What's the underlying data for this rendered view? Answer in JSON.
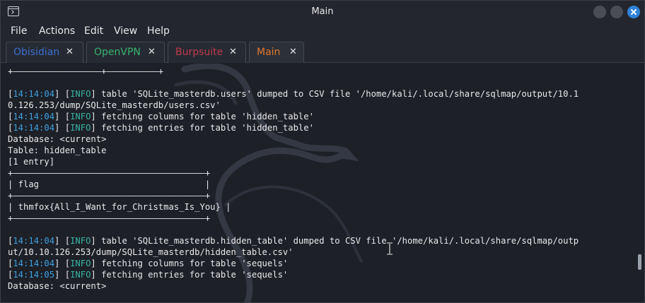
{
  "window": {
    "title": "Main"
  },
  "menu": [
    "File",
    "Actions",
    "Edit",
    "View",
    "Help"
  ],
  "tabs": [
    {
      "label": "Obisidian",
      "color": "#3b6fd1"
    },
    {
      "label": "OpenVPN",
      "color": "#37b36f"
    },
    {
      "label": "Burpsuite",
      "color": "#c03a4b"
    },
    {
      "label": "Main",
      "color": "#e0782d"
    }
  ],
  "terminal": {
    "lines": [
      [
        {
          "t": "+—————————————————+——————————+",
          "c": ""
        }
      ],
      [
        {
          "t": "",
          "c": ""
        }
      ],
      [
        {
          "t": "[",
          "c": ""
        },
        {
          "t": "14:14:04",
          "c": "ts"
        },
        {
          "t": "] [",
          "c": ""
        },
        {
          "t": "INFO",
          "c": "lvl"
        },
        {
          "t": "] table 'SQLite_masterdb.users' dumped to CSV file '/home/kali/.local/share/sqlmap/output/10.1",
          "c": ""
        }
      ],
      [
        {
          "t": "0.126.253/dump/SQLite_masterdb/users.csv'",
          "c": ""
        }
      ],
      [
        {
          "t": "[",
          "c": ""
        },
        {
          "t": "14:14:04",
          "c": "ts"
        },
        {
          "t": "] [",
          "c": ""
        },
        {
          "t": "INFO",
          "c": "lvl"
        },
        {
          "t": "] fetching columns for table 'hidden_table'",
          "c": ""
        }
      ],
      [
        {
          "t": "[",
          "c": ""
        },
        {
          "t": "14:14:04",
          "c": "ts"
        },
        {
          "t": "] [",
          "c": ""
        },
        {
          "t": "INFO",
          "c": "lvl"
        },
        {
          "t": "] fetching entries for table 'hidden_table'",
          "c": ""
        }
      ],
      [
        {
          "t": "Database: <current>",
          "c": ""
        }
      ],
      [
        {
          "t": "Table: hidden_table",
          "c": ""
        }
      ],
      [
        {
          "t": "[1 entry]",
          "c": ""
        }
      ],
      [
        {
          "t": "+—————————————————————————————————————+",
          "c": ""
        }
      ],
      [
        {
          "t": "| flag                                |",
          "c": ""
        }
      ],
      [
        {
          "t": "+—————————————————————————————————————+",
          "c": ""
        }
      ],
      [
        {
          "t": "| thmfox{All_I_Want_for_Christmas_Is_You} |",
          "c": ""
        }
      ],
      [
        {
          "t": "+—————————————————————————————————————+",
          "c": ""
        }
      ],
      [
        {
          "t": "",
          "c": ""
        }
      ],
      [
        {
          "t": "[",
          "c": ""
        },
        {
          "t": "14:14:04",
          "c": "ts"
        },
        {
          "t": "] [",
          "c": ""
        },
        {
          "t": "INFO",
          "c": "lvl"
        },
        {
          "t": "] table 'SQLite_masterdb.hidden_table' dumped to CSV file '/home/kali/.local/share/sqlmap/outp",
          "c": ""
        }
      ],
      [
        {
          "t": "ut/10.10.126.253/dump/SQLite_masterdb/hidden_table.csv'",
          "c": ""
        }
      ],
      [
        {
          "t": "[",
          "c": ""
        },
        {
          "t": "14:14:04",
          "c": "ts"
        },
        {
          "t": "] [",
          "c": ""
        },
        {
          "t": "INFO",
          "c": "lvl"
        },
        {
          "t": "] fetching columns for table 'sequels'",
          "c": ""
        }
      ],
      [
        {
          "t": "[",
          "c": ""
        },
        {
          "t": "14:14:05",
          "c": "ts"
        },
        {
          "t": "] [",
          "c": ""
        },
        {
          "t": "INFO",
          "c": "lvl"
        },
        {
          "t": "] fetching entries for table 'sequels'",
          "c": ""
        }
      ],
      [
        {
          "t": "Database: <current>",
          "c": ""
        }
      ]
    ]
  }
}
